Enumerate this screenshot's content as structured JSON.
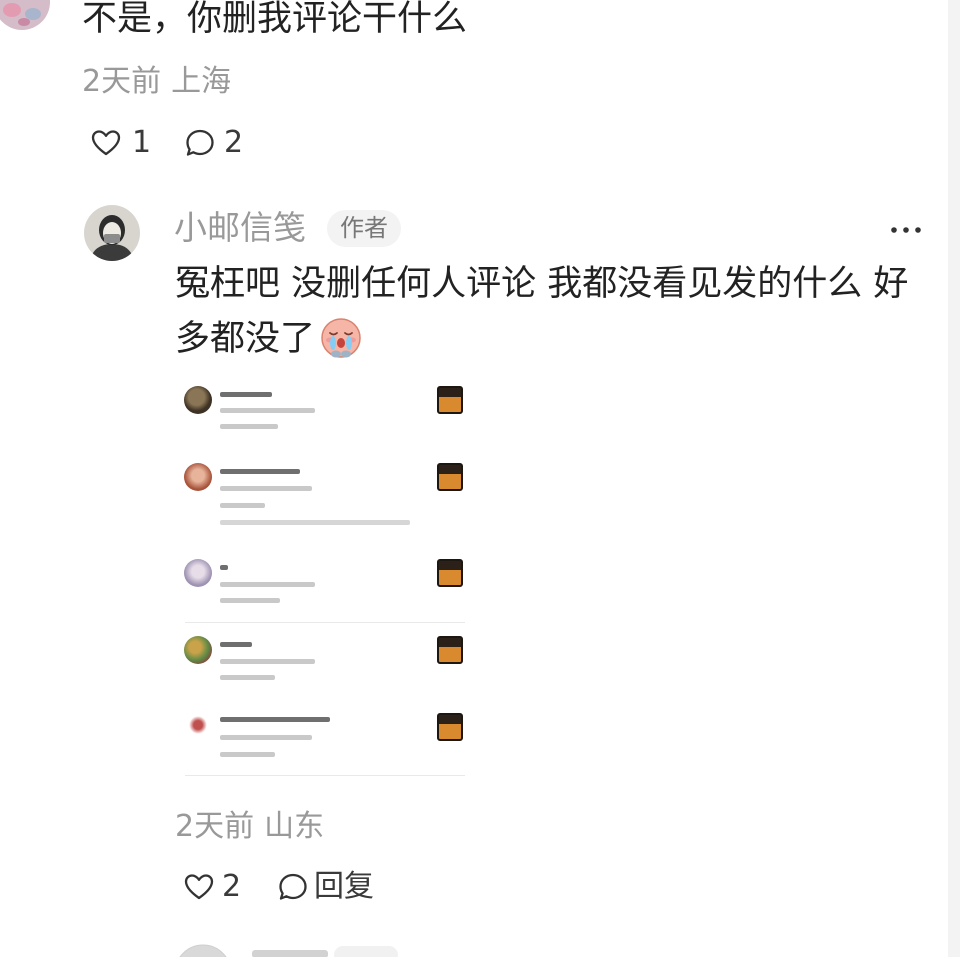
{
  "comment": {
    "text": "不是，你删我评论干什么",
    "time": "2天前",
    "location": "上海",
    "like_count": 1,
    "reply_count": 2
  },
  "reply": {
    "author": "小邮信笺",
    "badge": "作者",
    "text": "冤枉吧 没删任何人评论 我都没看见发的什么 好多都没了",
    "emoji": "crying-sticker",
    "time": "2天前",
    "location": "山东",
    "like_count": 2,
    "reply_label": "回复"
  },
  "icons": {
    "like": "heart-outline-icon",
    "comment": "comment-bubble-icon",
    "more": "more-dots-icon"
  },
  "colors": {
    "text_primary": "#222222",
    "text_secondary": "#999999",
    "badge_bg": "#f3f3f3",
    "icon": "#333333"
  }
}
